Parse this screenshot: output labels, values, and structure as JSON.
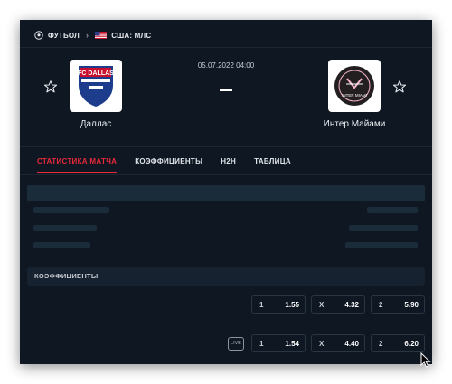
{
  "breadcrumb": {
    "sport": "ФУТБОЛ",
    "league": "США: МЛС",
    "icons": [
      "soccer-ball-icon",
      "chevron-right-icon",
      "usa-flag-icon"
    ]
  },
  "match": {
    "datetime": "05.07.2022 04:00",
    "score": "-",
    "home": {
      "name": "Даллас",
      "logo_text": "FC DALLAS",
      "favorite_icon": "star-outline-icon"
    },
    "away": {
      "name": "Интер Майами",
      "logo_text": "INTER MIAMI",
      "favorite_icon": "star-outline-icon"
    }
  },
  "tabs": [
    {
      "label": "СТАТИСТИКА МАТЧА",
      "active": true
    },
    {
      "label": "КОЭФФИЦИЕНТЫ",
      "active": false
    },
    {
      "label": "H2H",
      "active": false
    },
    {
      "label": "ТАБЛИЦА",
      "active": false
    }
  ],
  "odds": {
    "title": "КОЭФФИЦИЕНТЫ",
    "rows": [
      {
        "live": false,
        "items": [
          {
            "label": "1",
            "value": "1.55"
          },
          {
            "label": "X",
            "value": "4.32"
          },
          {
            "label": "2",
            "value": "5.90"
          }
        ]
      },
      {
        "live": true,
        "live_label": "LIVE",
        "items": [
          {
            "label": "1",
            "value": "1.54"
          },
          {
            "label": "X",
            "value": "4.40"
          },
          {
            "label": "2",
            "value": "6.20"
          }
        ]
      }
    ]
  },
  "colors": {
    "background": "#0f1722",
    "accent": "#e8293b",
    "skeleton": "#1a2b3a"
  }
}
